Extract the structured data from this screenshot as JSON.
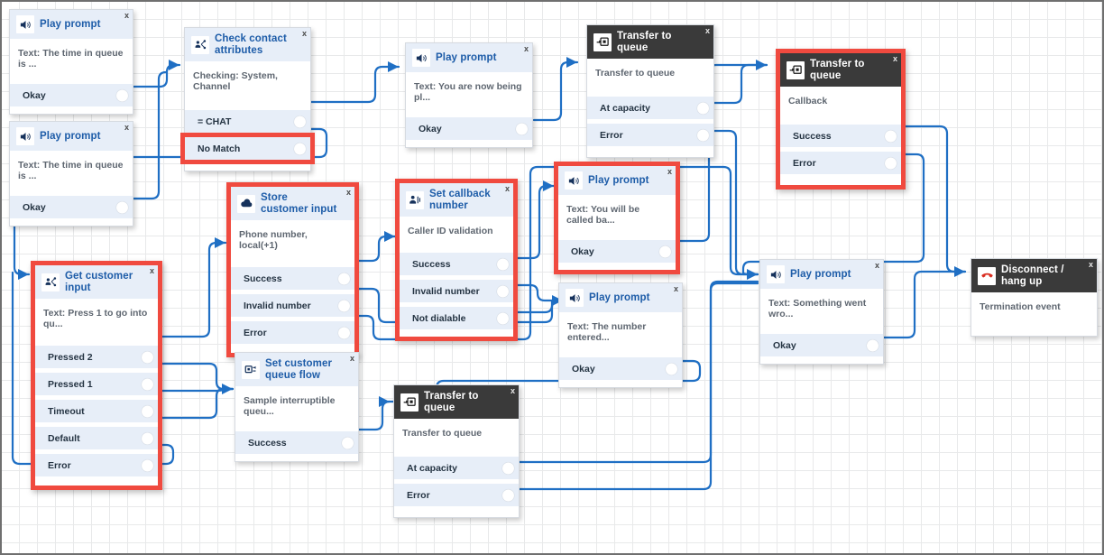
{
  "app": {
    "name": "contact-flow-designer",
    "canvas_label": "Contact flow canvas",
    "close_label": "x",
    "accent_blue": "#1d5ca8",
    "highlight_red": "#f04a3f",
    "wire_blue": "#1f6fc4",
    "header_blue": "#e7eef8",
    "header_dark": "#3a3a3a"
  },
  "nodes": [
    {
      "id": "play-prompt-queue-time-1",
      "title": "Play prompt",
      "icon": "speaker-icon",
      "style": "light",
      "highlight": false,
      "description": "Text: The time in queue is ...",
      "ports": [
        {
          "label": "Okay"
        }
      ]
    },
    {
      "id": "play-prompt-queue-time-2",
      "title": "Play prompt",
      "icon": "speaker-icon",
      "style": "light",
      "highlight": false,
      "description": "Text: The time in queue is ...",
      "ports": [
        {
          "label": "Okay"
        }
      ]
    },
    {
      "id": "check-contact-attributes",
      "title": "Check contact attributes",
      "icon": "branch-icon",
      "style": "light",
      "highlight": false,
      "description": "Checking: System, Channel",
      "ports": [
        {
          "label": "= CHAT",
          "highlight": false
        },
        {
          "label": "No Match",
          "highlight": true
        }
      ]
    },
    {
      "id": "play-prompt-being-placed",
      "title": "Play prompt",
      "icon": "speaker-icon",
      "style": "light",
      "highlight": false,
      "description": "Text: You are now being pl...",
      "ports": [
        {
          "label": "Okay"
        }
      ]
    },
    {
      "id": "transfer-to-queue-main",
      "title": "Transfer to queue",
      "icon": "transfer-icon",
      "style": "dark",
      "highlight": false,
      "description": "Transfer to queue",
      "ports": [
        {
          "label": "At capacity"
        },
        {
          "label": "Error"
        }
      ]
    },
    {
      "id": "transfer-to-queue-callback",
      "title": "Transfer to queue",
      "icon": "transfer-icon",
      "style": "dark",
      "highlight": true,
      "description": "Callback",
      "ports": [
        {
          "label": "Success"
        },
        {
          "label": "Error"
        }
      ]
    },
    {
      "id": "store-customer-input",
      "title": "Store customer input",
      "icon": "cloud-icon",
      "style": "light",
      "highlight": true,
      "description": "Phone number, local(+1)",
      "ports": [
        {
          "label": "Success"
        },
        {
          "label": "Invalid number"
        },
        {
          "label": "Error"
        }
      ]
    },
    {
      "id": "set-callback-number",
      "title": "Set callback number",
      "icon": "callback-icon",
      "style": "light",
      "highlight": true,
      "description": "Caller ID validation",
      "ports": [
        {
          "label": "Success"
        },
        {
          "label": "Invalid number"
        },
        {
          "label": "Not dialable"
        }
      ]
    },
    {
      "id": "play-prompt-called-back",
      "title": "Play prompt",
      "icon": "speaker-icon",
      "style": "light",
      "highlight": true,
      "description": "Text: You will be called ba...",
      "ports": [
        {
          "label": "Okay"
        }
      ]
    },
    {
      "id": "get-customer-input",
      "title": "Get customer input",
      "icon": "branch-icon",
      "style": "light",
      "highlight": true,
      "description": "Text: Press 1 to go into qu...",
      "ports": [
        {
          "label": "Pressed 2"
        },
        {
          "label": "Pressed 1"
        },
        {
          "label": "Timeout"
        },
        {
          "label": "Default"
        },
        {
          "label": "Error"
        }
      ]
    },
    {
      "id": "set-customer-queue-flow",
      "title": "Set customer queue flow",
      "icon": "queueflow-icon",
      "style": "light",
      "highlight": false,
      "description": "Sample interruptible queu...",
      "ports": [
        {
          "label": "Success"
        }
      ]
    },
    {
      "id": "play-prompt-number-entered",
      "title": "Play prompt",
      "icon": "speaker-icon",
      "style": "light",
      "highlight": false,
      "description": "Text: The number entered...",
      "ports": [
        {
          "label": "Okay"
        }
      ]
    },
    {
      "id": "transfer-to-queue-bottom",
      "title": "Transfer to queue",
      "icon": "transfer-icon",
      "style": "dark",
      "highlight": false,
      "description": "Transfer to queue",
      "ports": [
        {
          "label": "At capacity"
        },
        {
          "label": "Error"
        }
      ]
    },
    {
      "id": "play-prompt-something-wrong",
      "title": "Play prompt",
      "icon": "speaker-icon",
      "style": "light",
      "highlight": false,
      "description": "Text: Something went wro...",
      "ports": [
        {
          "label": "Okay"
        }
      ]
    },
    {
      "id": "disconnect-hang-up",
      "title": "Disconnect / hang up",
      "icon": "hangup-icon",
      "style": "dark",
      "highlight": false,
      "description": "Termination event",
      "ports": []
    }
  ]
}
